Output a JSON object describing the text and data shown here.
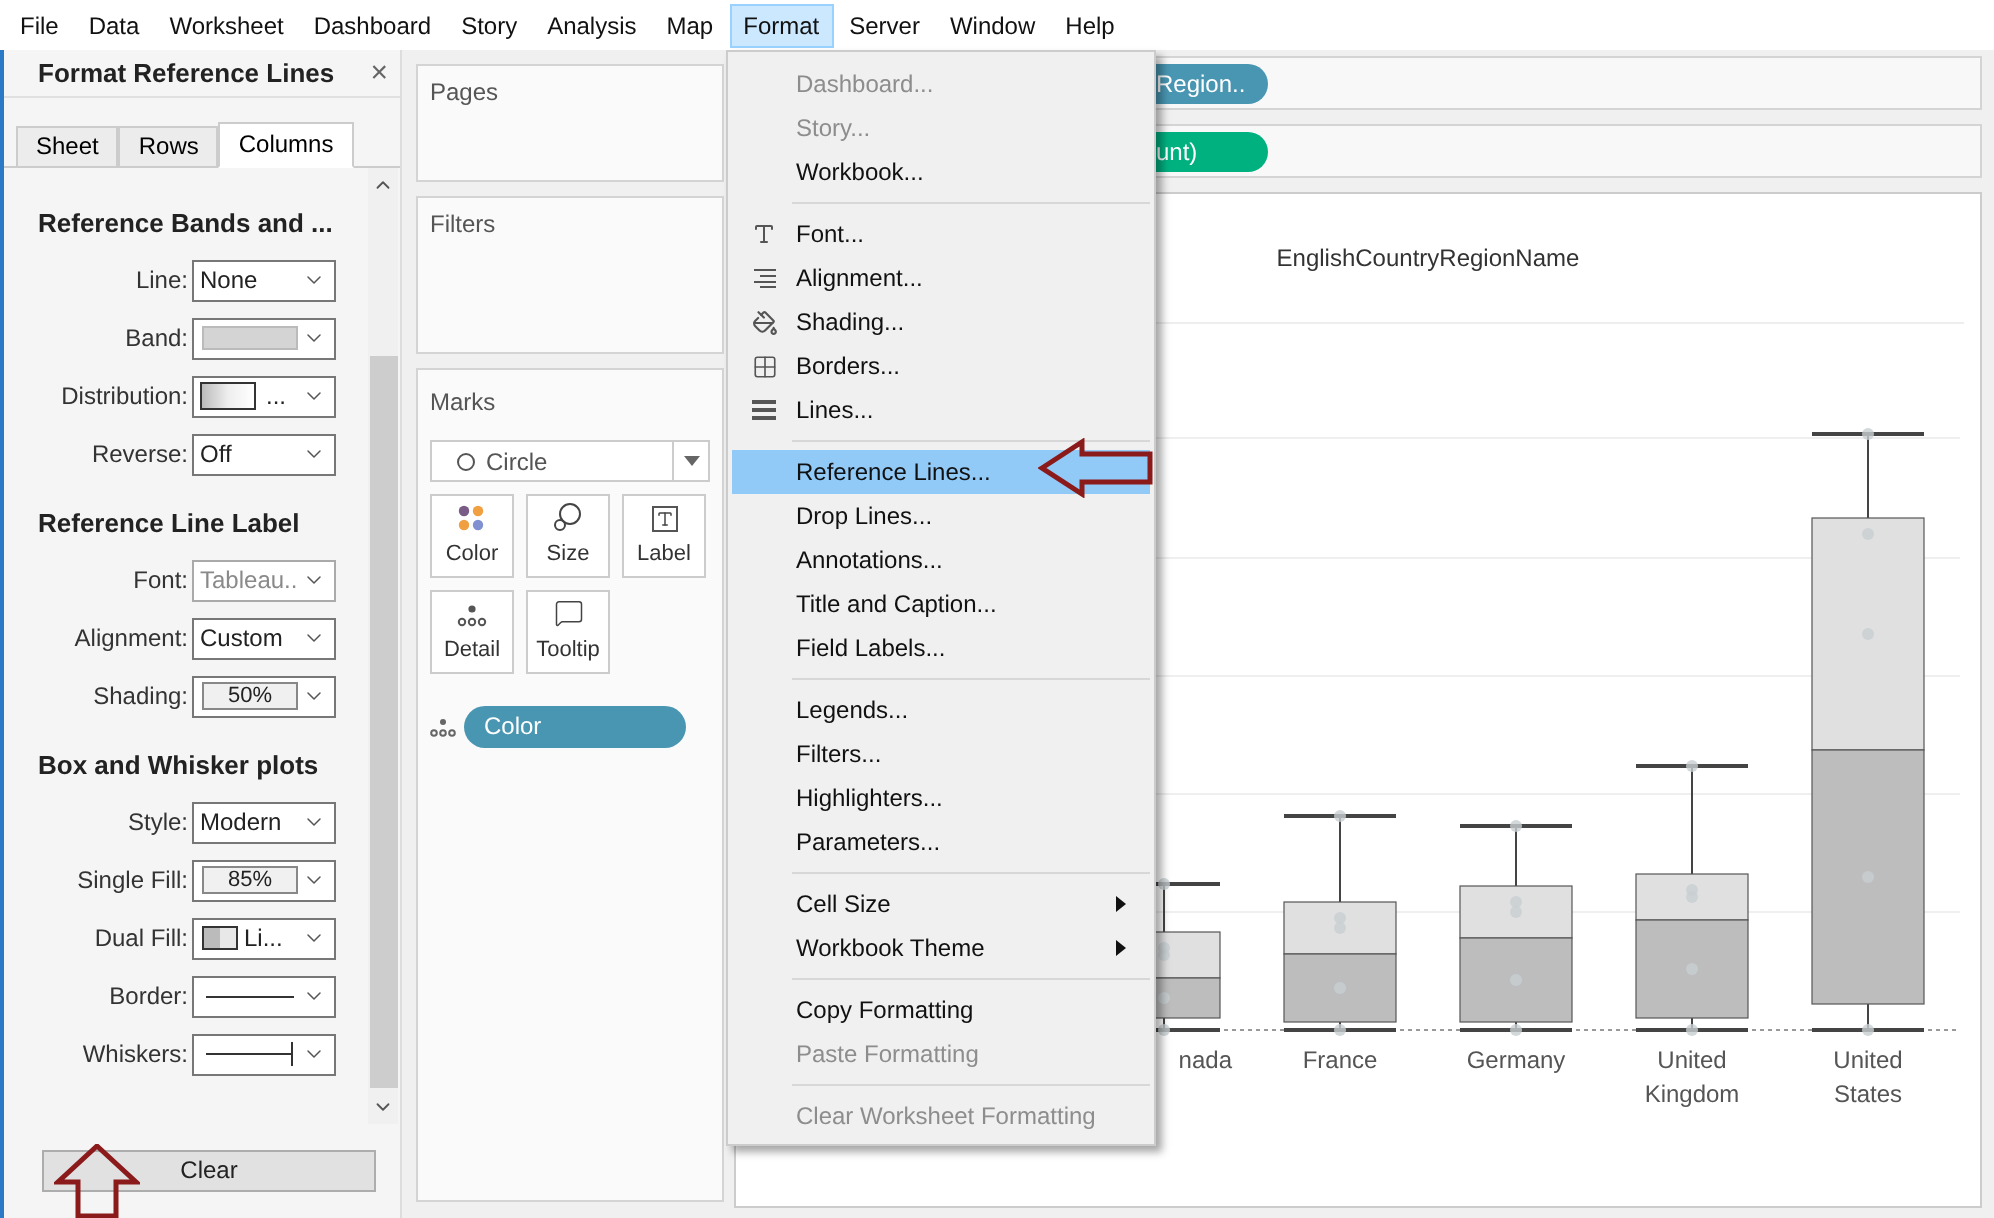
{
  "menubar": [
    {
      "label": "File",
      "selected": false
    },
    {
      "label": "Data",
      "selected": false
    },
    {
      "label": "Worksheet",
      "selected": false
    },
    {
      "label": "Dashboard",
      "selected": false
    },
    {
      "label": "Story",
      "selected": false
    },
    {
      "label": "Analysis",
      "selected": false
    },
    {
      "label": "Map",
      "selected": false
    },
    {
      "label": "Format",
      "selected": true
    },
    {
      "label": "Server",
      "selected": false
    },
    {
      "label": "Window",
      "selected": false
    },
    {
      "label": "Help",
      "selected": false
    }
  ],
  "format_panel": {
    "title": "Format Reference Lines",
    "close": "×",
    "tabs": [
      {
        "label": "Sheet",
        "selected": false
      },
      {
        "label": "Rows",
        "selected": false
      },
      {
        "label": "Columns",
        "selected": true
      }
    ],
    "sections": [
      {
        "title": "Reference Bands and ...",
        "rows": [
          {
            "label": "Line:",
            "kind": "select",
            "value": "None",
            "disabled": false
          },
          {
            "label": "Band:",
            "kind": "swatch",
            "disabled": false
          },
          {
            "label": "Distribution:",
            "kind": "gradient",
            "value": "...",
            "disabled": false
          },
          {
            "label": "Reverse:",
            "kind": "select",
            "value": "Off",
            "disabled": false
          }
        ]
      },
      {
        "title": "Reference Line Label",
        "rows": [
          {
            "label": "Font:",
            "kind": "select",
            "value": "Tableau..",
            "disabled": true
          },
          {
            "label": "Alignment:",
            "kind": "select",
            "value": "Custom",
            "disabled": false
          },
          {
            "label": "Shading:",
            "kind": "percent",
            "value": "50%",
            "disabled": false
          }
        ]
      },
      {
        "title": "Box and Whisker plots",
        "rows": [
          {
            "label": "Style:",
            "kind": "select",
            "value": "Modern",
            "disabled": false
          },
          {
            "label": "Single Fill:",
            "kind": "percent",
            "value": "85%",
            "disabled": false
          },
          {
            "label": "Dual Fill:",
            "kind": "dual",
            "value": "Li...",
            "disabled": false
          },
          {
            "label": "Border:",
            "kind": "line",
            "disabled": false
          },
          {
            "label": "Whiskers:",
            "kind": "whisker",
            "disabled": false
          }
        ]
      }
    ],
    "clear_button": "Clear"
  },
  "shelves": {
    "pages": "Pages",
    "filters": "Filters",
    "marks": {
      "title": "Marks",
      "mark_type": "Circle",
      "cards": [
        "Color",
        "Size",
        "Label",
        "Detail",
        "Tooltip"
      ],
      "pill": "Color"
    }
  },
  "view": {
    "columns_pill": "Region..",
    "rows_pill": "unt)",
    "header": "EnglishCountryRegionName",
    "categories": [
      "nada",
      "France",
      "Germany",
      "United Kingdom",
      "United States"
    ]
  },
  "format_menu": {
    "groups": [
      [
        {
          "label": "Dashboard...",
          "disabled": true,
          "selected": false,
          "submenu": false
        },
        {
          "label": "Story...",
          "disabled": true,
          "selected": false,
          "submenu": false
        },
        {
          "label": "Workbook...",
          "disabled": false,
          "selected": false,
          "submenu": false
        }
      ],
      [
        {
          "label": "Font...",
          "disabled": false,
          "selected": false,
          "submenu": false
        },
        {
          "label": "Alignment...",
          "disabled": false,
          "selected": false,
          "submenu": false
        },
        {
          "label": "Shading...",
          "disabled": false,
          "selected": false,
          "submenu": false
        },
        {
          "label": "Borders...",
          "disabled": false,
          "selected": false,
          "submenu": false
        },
        {
          "label": "Lines...",
          "disabled": false,
          "selected": false,
          "submenu": false
        }
      ],
      [
        {
          "label": "Reference Lines...",
          "disabled": false,
          "selected": true,
          "submenu": false
        },
        {
          "label": "Drop Lines...",
          "disabled": false,
          "selected": false,
          "submenu": false
        },
        {
          "label": "Annotations...",
          "disabled": false,
          "selected": false,
          "submenu": false
        },
        {
          "label": "Title and Caption...",
          "disabled": false,
          "selected": false,
          "submenu": false
        },
        {
          "label": "Field Labels...",
          "disabled": false,
          "selected": false,
          "submenu": false
        }
      ],
      [
        {
          "label": "Legends...",
          "disabled": false,
          "selected": false,
          "submenu": false
        },
        {
          "label": "Filters...",
          "disabled": false,
          "selected": false,
          "submenu": false
        },
        {
          "label": "Highlighters...",
          "disabled": false,
          "selected": false,
          "submenu": false
        },
        {
          "label": "Parameters...",
          "disabled": false,
          "selected": false,
          "submenu": false
        }
      ],
      [
        {
          "label": "Cell Size",
          "disabled": false,
          "selected": false,
          "submenu": true
        },
        {
          "label": "Workbook Theme",
          "disabled": false,
          "selected": false,
          "submenu": true
        }
      ],
      [
        {
          "label": "Copy Formatting",
          "disabled": false,
          "selected": false,
          "submenu": false
        },
        {
          "label": "Paste Formatting",
          "disabled": true,
          "selected": false,
          "submenu": false
        }
      ],
      [
        {
          "label": "Clear Worksheet Formatting",
          "disabled": true,
          "selected": false,
          "submenu": false
        }
      ]
    ]
  }
}
